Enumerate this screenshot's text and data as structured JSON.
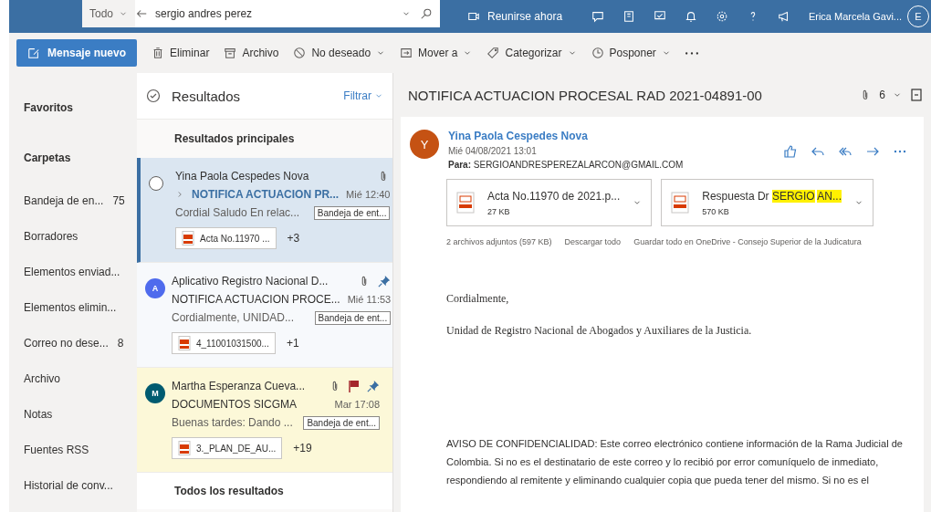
{
  "top_bar": {
    "scope": "Todo",
    "search": "sergio andres perez",
    "meet": "Reunirse ahora",
    "user": "Erica Marcela Gavi...",
    "avatar": "E"
  },
  "toolbar": {
    "new_message": "Mensaje nuevo",
    "actions": [
      {
        "label": "Eliminar",
        "kind": "trash",
        "dropdown": false
      },
      {
        "label": "Archivo",
        "kind": "archive",
        "dropdown": false
      },
      {
        "label": "No deseado",
        "kind": "block",
        "dropdown": true
      },
      {
        "label": "Mover a",
        "kind": "move",
        "dropdown": true
      },
      {
        "label": "Categorizar",
        "kind": "tag",
        "dropdown": true
      },
      {
        "label": "Posponer",
        "kind": "clock",
        "dropdown": true
      }
    ]
  },
  "nav": [
    {
      "label": "Favoritos",
      "kind": "header"
    },
    {
      "label": "Carpetas",
      "kind": "header"
    },
    {
      "label": "Bandeja de en...",
      "kind": "folder",
      "count": "75"
    },
    {
      "label": "Borradores",
      "kind": "folder"
    },
    {
      "label": "Elementos enviad...",
      "kind": "folder"
    },
    {
      "label": "Elementos elimin...",
      "kind": "folder"
    },
    {
      "label": "Correo no dese...",
      "kind": "folder",
      "count": "8"
    },
    {
      "label": "Archivo",
      "kind": "folder"
    },
    {
      "label": "Notas",
      "kind": "folder"
    },
    {
      "label": "Fuentes RSS",
      "kind": "folder"
    },
    {
      "label": "Historial de conv...",
      "kind": "folder"
    }
  ],
  "list": {
    "title": "Resultados",
    "filter": "Filtrar",
    "section": "Resultados principales",
    "footer": "Todos los resultados",
    "messages": [
      {
        "sender": "Yina Paola Cespedes Nova",
        "subject": "NOTIFICA ACTUACION PR...",
        "date": "Mié 12:40",
        "preview": "Cordial Saludo En relac...",
        "folder": "Bandeja de ent...",
        "attachment": "Acta No.11970 ...",
        "more": "+3",
        "selected": true,
        "unread": true,
        "flagged": false,
        "pinned": false
      },
      {
        "sender": "Aplicativo Registro Nacional D...",
        "subject": "NOTIFICA ACTUACION PROCE...",
        "date": "Mié 11:53",
        "preview": "Cordialmente, UNIDAD...",
        "folder": "Bandeja de ent...",
        "attachment": "4_11001031500...",
        "more": "+1",
        "avatar": "A",
        "color": "#4f6bed",
        "selected": false,
        "unread": false,
        "flagged": false,
        "pinned": true
      },
      {
        "sender": "Martha Esperanza Cueva...",
        "subject": "DOCUMENTOS SICGMA",
        "date": "Mar 17:08",
        "preview": "Buenas tardes: Dando ...",
        "folder": "Bandeja de ent...",
        "attachment": "3._PLAN_DE_AU...",
        "more": "+19",
        "avatar": "M",
        "color": "#005b70",
        "selected": false,
        "unread": false,
        "flagged": true,
        "pinned": true
      }
    ]
  },
  "reading": {
    "subject": "NOTIFICA ACTUACION PROCESAL RAD 2021-04891-00",
    "attachment_count": "6",
    "avatar": "Y",
    "sender": "Yina Paola Cespedes Nova",
    "date": "Mié 04/08/2021 13:01",
    "to_label": "Para:",
    "to": "SERGIOANDRESPEREZALARCON@GMAIL.COM",
    "attachments": [
      {
        "parts": [
          {
            "text": "Acta No.11970 de 2021.p...",
            "highlighted": false
          }
        ],
        "size": "27 KB"
      },
      {
        "parts": [
          {
            "text": "Respuesta Dr",
            "highlighted": false
          },
          {
            "text": "SERGIO",
            "highlighted": true
          },
          {
            "text": "AN...",
            "highlighted": true
          }
        ],
        "size": "570 KB"
      }
    ],
    "summary": "2 archivos adjuntos (597 KB)",
    "download": "Descargar todo",
    "save": "Guardar todo en OneDrive - Consejo Superior de la Judicatura",
    "body": [
      {
        "text": "Cordialmente,",
        "kind": "serif"
      },
      {
        "text": "Unidad de Registro Nacional de Abogados y Auxiliares de la Justicia.",
        "kind": "serif"
      },
      {
        "text": "AVISO DE CONFIDENCIALIDAD: Este correo electrónico contiene información de la Rama Judicial de Colombia. Si no es el destinatario de este correo y lo recibió por error comuníquelo de inmediato, respondiendo al remitente y eliminando cualquier copia que pueda tener del mismo. Si no es el",
        "kind": "sans"
      }
    ]
  }
}
